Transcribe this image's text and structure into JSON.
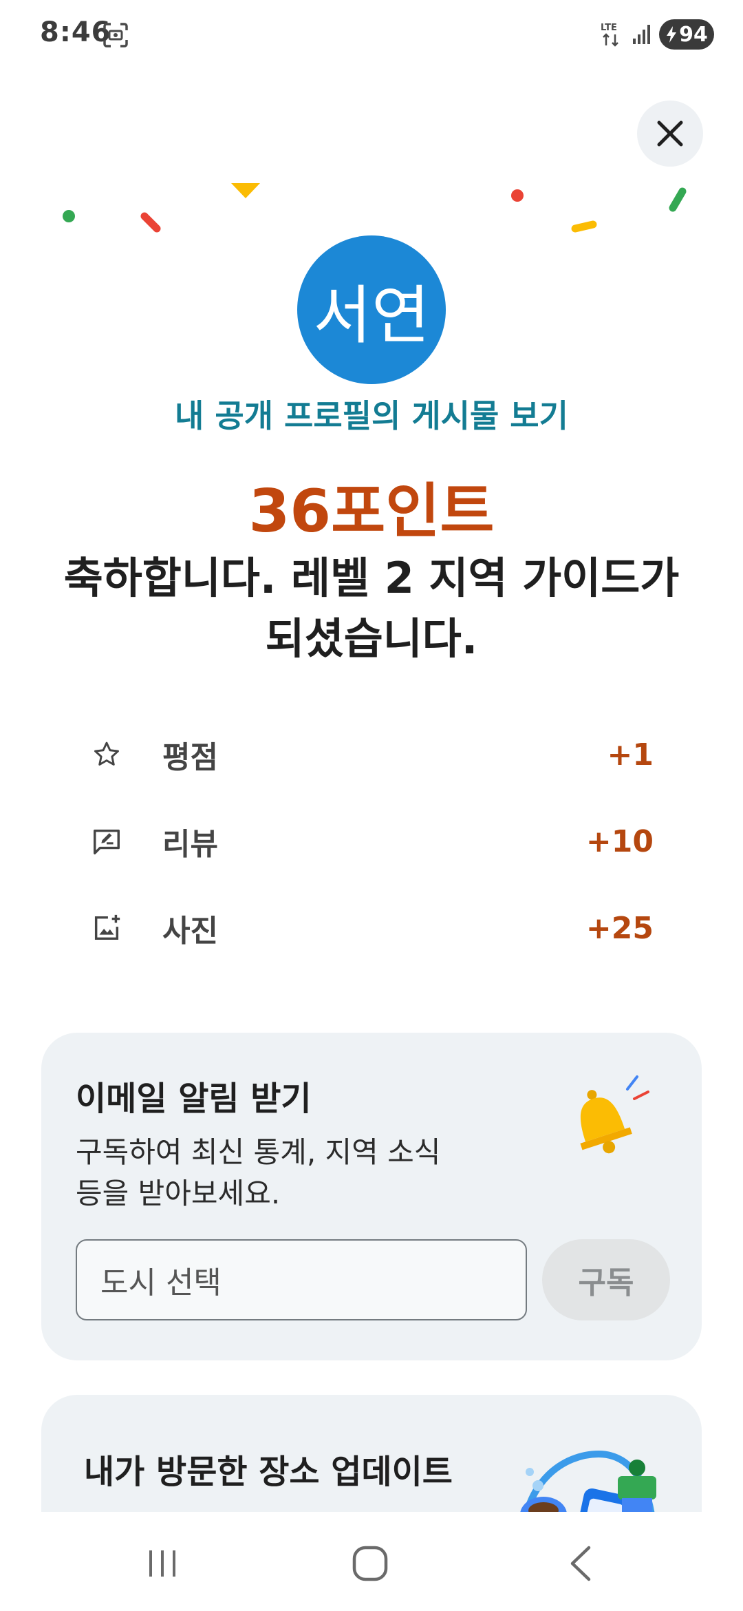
{
  "status_bar": {
    "time": "8:46",
    "network": "LTE",
    "battery": "94"
  },
  "avatar": {
    "initials": "서연",
    "color": "#1c88d6"
  },
  "profile_link": "내 공개 프로필의 게시물 보기",
  "points": "36포인트",
  "headline_line1": "축하합니다. 레벨 2 지역 가이드가",
  "headline_line2": "되셨습니다.",
  "stats": [
    {
      "icon": "star-outline-icon",
      "label": "평점",
      "value": "+1"
    },
    {
      "icon": "review-edit-icon",
      "label": "리뷰",
      "value": "+10"
    },
    {
      "icon": "add-photo-icon",
      "label": "사진",
      "value": "+25"
    }
  ],
  "email_card": {
    "title": "이메일 알림 받기",
    "description_line1": "구독하여 최신 통계, 지역 소식",
    "description_line2": "등을 받아보세요.",
    "city_placeholder": "도시 선택",
    "subscribe_label": "구독"
  },
  "places_card": {
    "title": "내가 방문한 장소 업데이트"
  },
  "colors": {
    "accent_orange": "#c1470e",
    "link_teal": "#137c93",
    "card_bg": "#eef2f5"
  }
}
